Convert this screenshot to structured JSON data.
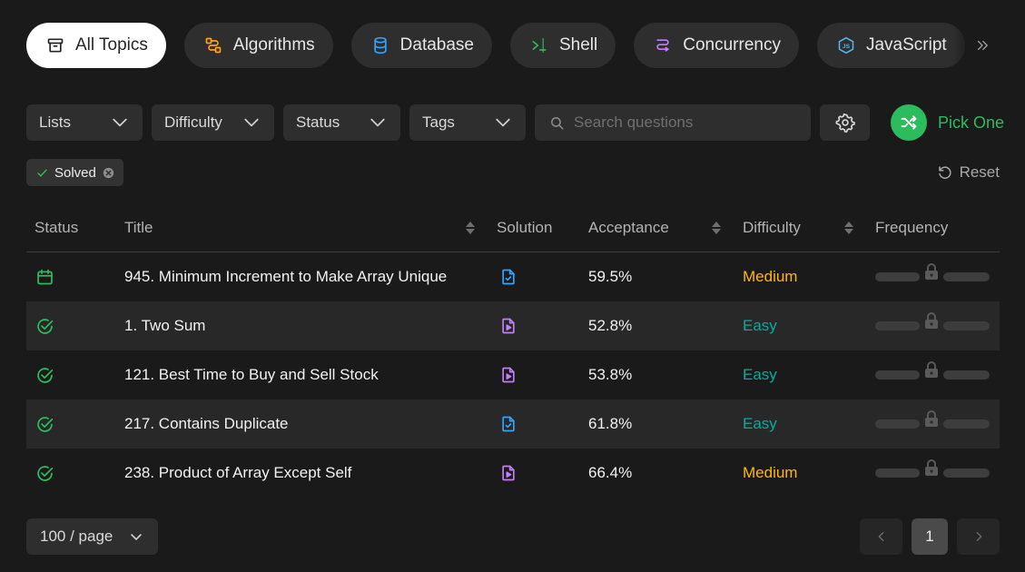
{
  "topics": [
    {
      "label": "All Topics",
      "icon": "archive-icon",
      "color": "#262626",
      "active": true
    },
    {
      "label": "Algorithms",
      "icon": "algorithms-icon",
      "color": "#ffa116",
      "active": false
    },
    {
      "label": "Database",
      "icon": "database-icon",
      "color": "#2fa4ff",
      "active": false
    },
    {
      "label": "Shell",
      "icon": "terminal-icon",
      "color": "#2cbb5d",
      "active": false
    },
    {
      "label": "Concurrency",
      "icon": "concurrency-icon",
      "color": "#c27ff5",
      "active": false
    },
    {
      "label": "JavaScript",
      "icon": "javascript-icon",
      "color": "#5bb7e6",
      "active": false
    }
  ],
  "filters": {
    "lists": "Lists",
    "difficulty": "Difficulty",
    "status": "Status",
    "tags": "Tags",
    "search_placeholder": "Search questions",
    "pick_one": "Pick One"
  },
  "active_filter": {
    "label": "Solved"
  },
  "reset_label": "Reset",
  "table": {
    "headers": {
      "status": "Status",
      "title": "Title",
      "solution": "Solution",
      "acceptance": "Acceptance",
      "difficulty": "Difficulty",
      "frequency": "Frequency"
    },
    "rows": [
      {
        "status_icon": "calendar-icon",
        "title": "945. Minimum Increment to Make Array Unique",
        "solution_icon": "article-icon",
        "acceptance": "59.5%",
        "difficulty": "Medium"
      },
      {
        "status_icon": "solved-check-icon",
        "title": "1. Two Sum",
        "solution_icon": "video-icon",
        "acceptance": "52.8%",
        "difficulty": "Easy"
      },
      {
        "status_icon": "solved-check-icon",
        "title": "121. Best Time to Buy and Sell Stock",
        "solution_icon": "video-icon",
        "acceptance": "53.8%",
        "difficulty": "Easy"
      },
      {
        "status_icon": "solved-check-icon",
        "title": "217. Contains Duplicate",
        "solution_icon": "article-icon",
        "acceptance": "61.8%",
        "difficulty": "Easy"
      },
      {
        "status_icon": "solved-check-icon",
        "title": "238. Product of Array Except Self",
        "solution_icon": "video-icon",
        "acceptance": "66.4%",
        "difficulty": "Medium"
      }
    ]
  },
  "pagination": {
    "per_page": "100 / page",
    "current_page": "1"
  },
  "colors": {
    "easy": "#00af9b",
    "medium": "#ffb800",
    "solved": "#2cbb5d",
    "article": "#2fa4ff",
    "video": "#c27ff5"
  }
}
